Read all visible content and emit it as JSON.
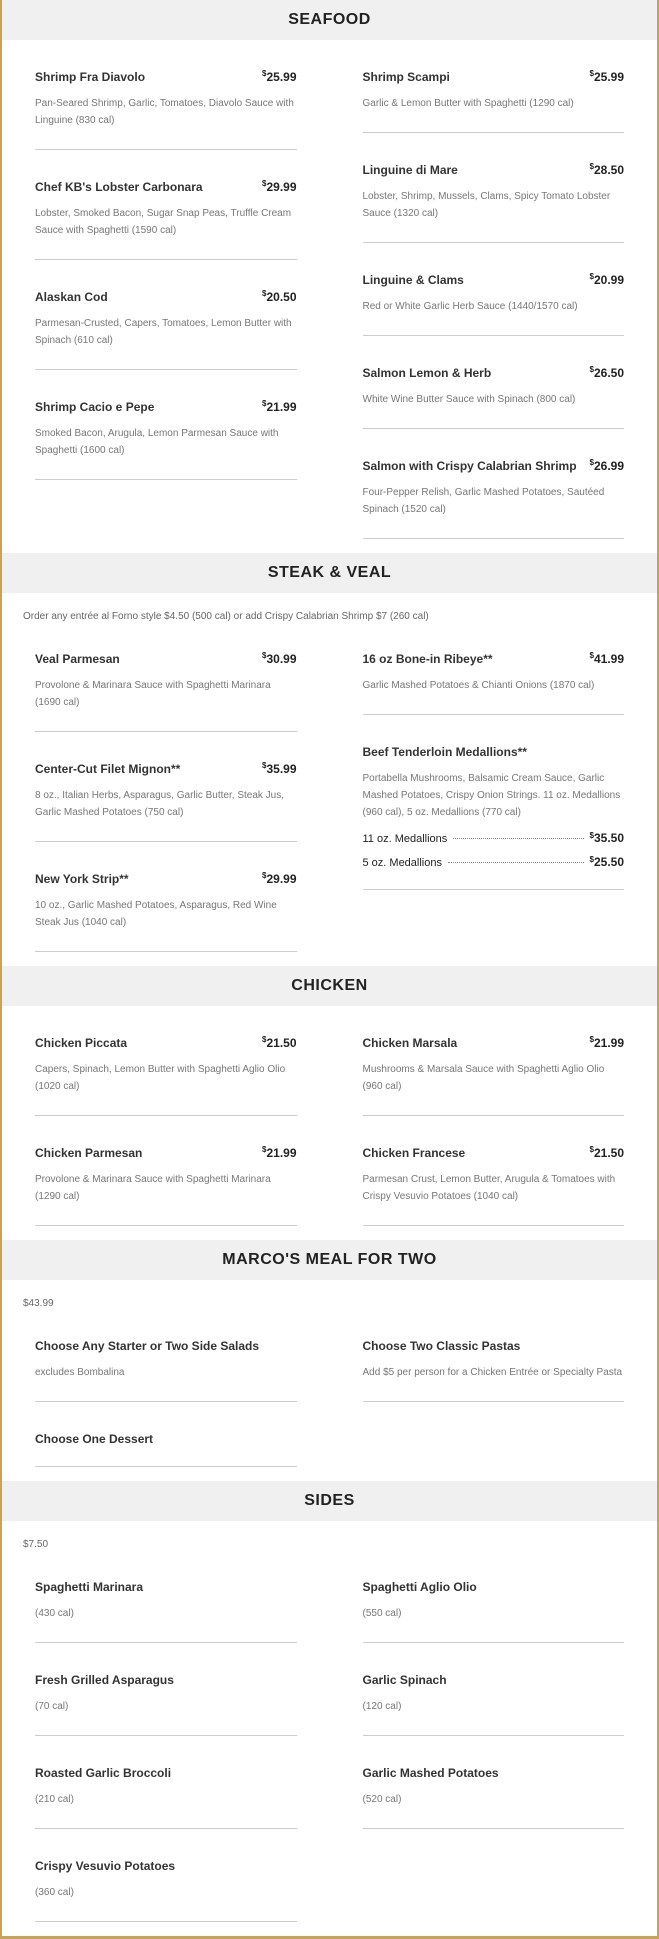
{
  "sections": [
    {
      "title": "SEAFOOD",
      "note": "",
      "left": [
        {
          "name": "Shrimp Fra Diavolo",
          "price": "25.99",
          "desc": "Pan-Seared Shrimp, Garlic, Tomatoes, Diavolo Sauce with Linguine (830 cal)"
        },
        {
          "name": "Chef KB's Lobster Carbonara",
          "price": "29.99",
          "desc": "Lobster, Smoked Bacon, Sugar Snap Peas, Truffle Cream Sauce with Spaghetti (1590 cal)"
        },
        {
          "name": "Alaskan Cod",
          "price": "20.50",
          "desc": "Parmesan-Crusted, Capers, Tomatoes, Lemon Butter with Spinach (610 cal)"
        },
        {
          "name": "Shrimp Cacio e Pepe",
          "price": "21.99",
          "desc": "Smoked Bacon, Arugula, Lemon Parmesan Sauce with Spaghetti (1600 cal)"
        }
      ],
      "right": [
        {
          "name": "Shrimp Scampi",
          "price": "25.99",
          "desc": "Garlic & Lemon Butter with Spaghetti (1290 cal)"
        },
        {
          "name": "Linguine di Mare",
          "price": "28.50",
          "desc": "Lobster, Shrimp, Mussels, Clams, Spicy Tomato Lobster Sauce (1320 cal)"
        },
        {
          "name": "Linguine & Clams",
          "price": "20.99",
          "desc": "Red or White Garlic Herb Sauce (1440/1570 cal)"
        },
        {
          "name": "Salmon Lemon & Herb",
          "price": "26.50",
          "desc": "White Wine Butter Sauce with Spinach (800 cal)"
        },
        {
          "name": "Salmon with Crispy Calabrian Shrimp",
          "price": "26.99",
          "desc": "Four-Pepper Relish, Garlic Mashed Potatoes, Sautéed Spinach (1520 cal)"
        }
      ]
    },
    {
      "title": "STEAK & VEAL",
      "note": "Order any entrée al Forno style $4.50 (500 cal) or add Crispy Calabrian Shrimp $7 (260 cal)",
      "left": [
        {
          "name": "Veal Parmesan",
          "price": "30.99",
          "desc": "Provolone & Marinara Sauce with Spaghetti Marinara (1690 cal)"
        },
        {
          "name": "Center-Cut Filet Mignon**",
          "price": "35.99",
          "desc": "8 oz., Italian Herbs, Asparagus, Garlic Butter, Steak Jus, Garlic Mashed Potatoes (750 cal)"
        },
        {
          "name": "New York Strip**",
          "price": "29.99",
          "desc": "10 oz., Garlic Mashed Potatoes, Asparagus, Red Wine Steak Jus (1040 cal)"
        }
      ],
      "right": [
        {
          "name": "16 oz Bone-in Ribeye**",
          "price": "41.99",
          "desc": "Garlic Mashed Potatoes & Chianti Onions (1870 cal)"
        },
        {
          "name": "Beef Tenderloin Medallions**",
          "price": "",
          "desc": "Portabella Mushrooms, Balsamic Cream Sauce, Garlic Mashed Potatoes, Crispy Onion Strings. 11 oz. Medallions (960 cal), 5 oz. Medallions (770 cal)",
          "sub": [
            {
              "label": "11 oz. Medallions",
              "price": "35.50"
            },
            {
              "label": "5 oz. Medallions",
              "price": "25.50"
            }
          ]
        }
      ]
    },
    {
      "title": "CHICKEN",
      "note": "",
      "left": [
        {
          "name": "Chicken Piccata",
          "price": "21.50",
          "desc": "Capers, Spinach, Lemon Butter with Spaghetti Aglio Olio (1020 cal)"
        },
        {
          "name": "Chicken Parmesan",
          "price": "21.99",
          "desc": "Provolone & Marinara Sauce with Spaghetti Marinara (1290 cal)"
        }
      ],
      "right": [
        {
          "name": "Chicken Marsala",
          "price": "21.99",
          "desc": "Mushrooms & Marsala Sauce with Spaghetti Aglio Olio (960 cal)"
        },
        {
          "name": "Chicken Francese",
          "price": "21.50",
          "desc": "Parmesan Crust, Lemon Butter, Arugula & Tomatoes with Crispy Vesuvio Potatoes (1040 cal)"
        }
      ]
    },
    {
      "title": "MARCO'S MEAL FOR TWO",
      "note": "$43.99",
      "left": [
        {
          "name": "Choose Any Starter or Two Side Salads",
          "price": "",
          "desc": "excludes Bombalina"
        },
        {
          "name": "Choose One Dessert",
          "price": "",
          "desc": ""
        }
      ],
      "right": [
        {
          "name": "Choose Two Classic Pastas",
          "price": "",
          "desc": "Add $5 per person for a Chicken Entrée or Specialty Pasta"
        }
      ]
    },
    {
      "title": "SIDES",
      "note": "$7.50",
      "left": [
        {
          "name": "Spaghetti Marinara",
          "price": "",
          "desc": "(430 cal)"
        },
        {
          "name": "Fresh Grilled Asparagus",
          "price": "",
          "desc": "(70 cal)"
        },
        {
          "name": "Roasted Garlic Broccoli",
          "price": "",
          "desc": "(210 cal)"
        },
        {
          "name": "Crispy Vesuvio Potatoes",
          "price": "",
          "desc": "(360 cal)"
        }
      ],
      "right": [
        {
          "name": "Spaghetti Aglio Olio",
          "price": "",
          "desc": "(550 cal)"
        },
        {
          "name": "Garlic Spinach",
          "price": "",
          "desc": "(120 cal)"
        },
        {
          "name": "Garlic Mashed Potatoes",
          "price": "",
          "desc": "(520 cal)"
        }
      ]
    }
  ],
  "currency_symbol": "$"
}
